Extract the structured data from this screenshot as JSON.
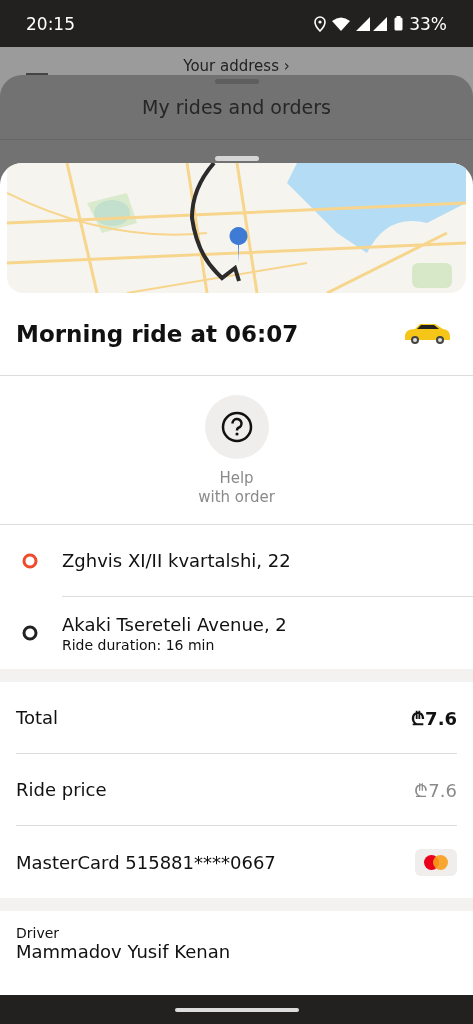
{
  "status_bar": {
    "time": "20:15",
    "battery": "33%"
  },
  "background": {
    "address_link": "Your address ›"
  },
  "rides_sheet": {
    "title": "My rides and orders"
  },
  "order": {
    "title": "Morning ride at 06:07",
    "help": {
      "label": "Help\nwith order"
    },
    "route": [
      {
        "kind": "start",
        "address": "Zghvis XI/II kvartalshi, 22"
      },
      {
        "kind": "end",
        "address": "Akaki Tsereteli Avenue, 2",
        "note": "Ride duration: 16 min"
      }
    ],
    "payment": [
      {
        "kind": "total",
        "label": "Total",
        "amount": "₾7.6"
      },
      {
        "kind": "price",
        "label": "Ride price",
        "amount": "₾7.6"
      },
      {
        "kind": "card",
        "label": "MasterCard 515881****0667"
      }
    ],
    "driver": {
      "caption": "Driver",
      "name": "Mammadov Yusif Kenan"
    }
  }
}
